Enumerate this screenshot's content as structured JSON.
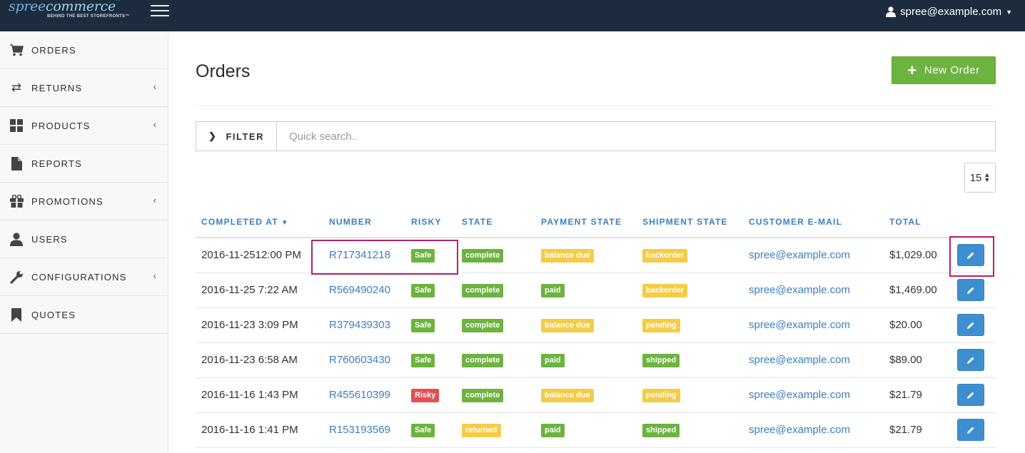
{
  "brand": {
    "name_a": "spree",
    "name_b": "commerce",
    "tm": "™",
    "tagline": "BEHIND THE BEST STOREFRONTS™"
  },
  "header": {
    "user_email": "spree@example.com"
  },
  "sidebar": {
    "items": [
      {
        "label": "ORDERS",
        "icon": "cart-icon"
      },
      {
        "label": "RETURNS",
        "icon": "transfer-icon"
      },
      {
        "label": "PRODUCTS",
        "icon": "grid-icon"
      },
      {
        "label": "REPORTS",
        "icon": "file-icon"
      },
      {
        "label": "PROMOTIONS",
        "icon": "gift-icon"
      },
      {
        "label": "USERS",
        "icon": "user-icon"
      },
      {
        "label": "CONFIGURATIONS",
        "icon": "wrench-icon"
      },
      {
        "label": "QUOTES",
        "icon": "bookmark-icon"
      }
    ]
  },
  "page": {
    "title": "Orders",
    "new_order_label": "New Order"
  },
  "filter": {
    "label": "FILTER",
    "search_placeholder": "Quick search..",
    "per_page": "15"
  },
  "table": {
    "columns": [
      "COMPLETED AT",
      "NUMBER",
      "RISKY",
      "STATE",
      "PAYMENT STATE",
      "SHIPMENT STATE",
      "CUSTOMER E-MAIL",
      "TOTAL"
    ],
    "rows": [
      {
        "completed_at": "2016-11-2512:00 PM",
        "number": "R717341218",
        "risky": "Safe",
        "state": "complete",
        "payment_state": "balance due",
        "shipment_state": "backorder",
        "email": "spree@example.com",
        "total": "$1,029.00"
      },
      {
        "completed_at": "2016-11-25 7:22 AM",
        "number": "R569490240",
        "risky": "Safe",
        "state": "complete",
        "payment_state": "paid",
        "shipment_state": "backorder",
        "email": "spree@example.com",
        "total": "$1,469.00"
      },
      {
        "completed_at": "2016-11-23 3:09 PM",
        "number": "R379439303",
        "risky": "Safe",
        "state": "complete",
        "payment_state": "balance due",
        "shipment_state": "pending",
        "email": "spree@example.com",
        "total": "$20.00"
      },
      {
        "completed_at": "2016-11-23 6:58 AM",
        "number": "R760603430",
        "risky": "Safe",
        "state": "complete",
        "payment_state": "paid",
        "shipment_state": "shipped",
        "email": "spree@example.com",
        "total": "$89.00"
      },
      {
        "completed_at": "2016-11-16 1:43 PM",
        "number": "R455610399",
        "risky": "Risky",
        "state": "complete",
        "payment_state": "balance due",
        "shipment_state": "pending",
        "email": "spree@example.com",
        "total": "$21.79"
      },
      {
        "completed_at": "2016-11-16 1:41 PM",
        "number": "R153193569",
        "risky": "Safe",
        "state": "returned",
        "payment_state": "paid",
        "shipment_state": "shipped",
        "email": "spree@example.com",
        "total": "$21.79"
      }
    ]
  },
  "colors": {
    "topbar": "#1c2b3d",
    "link": "#3a7fc1",
    "success": "#6db33f",
    "warning": "#f5cc47",
    "danger": "#e45050",
    "primary": "#3d8fd0",
    "highlight": "#b5226f"
  }
}
